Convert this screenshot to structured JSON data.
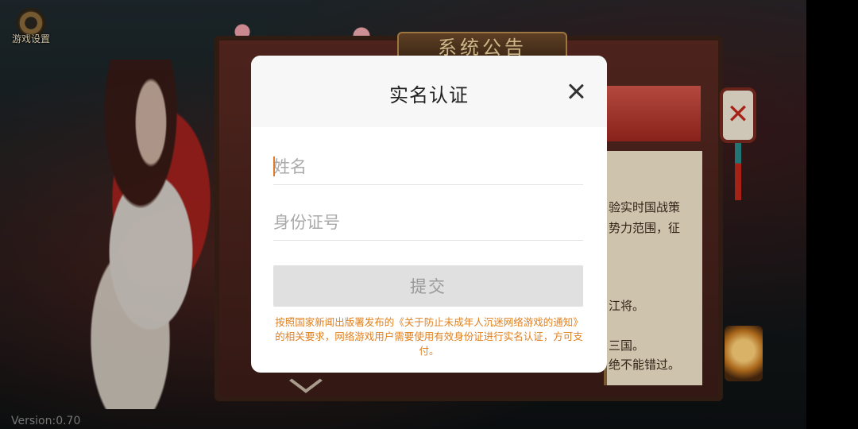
{
  "game": {
    "settings_label": "游戏设置",
    "board_title": "系统公告",
    "notice_lines": [
      "验实时国战策",
      "势力范围，征",
      "江将。",
      "三国。",
      "绝不能错过。"
    ],
    "lantern_glyph": "✕",
    "version": "Version:0.70"
  },
  "dialog": {
    "title": "实名认证",
    "name_placeholder": "姓名",
    "name_value": "",
    "id_placeholder": "身份证号",
    "id_value": "",
    "submit_label": "提交",
    "notice": "按照国家新闻出版署发布的《关于防止未成年人沉迷网络游戏的通知》的相关要求，网络游戏用户需要使用有效身份证进行实名认证，方可支付。"
  },
  "colors": {
    "notice_text": "#e0801f",
    "submit_bg": "#e0e0e0",
    "header_bg": "#f7f7f7"
  }
}
